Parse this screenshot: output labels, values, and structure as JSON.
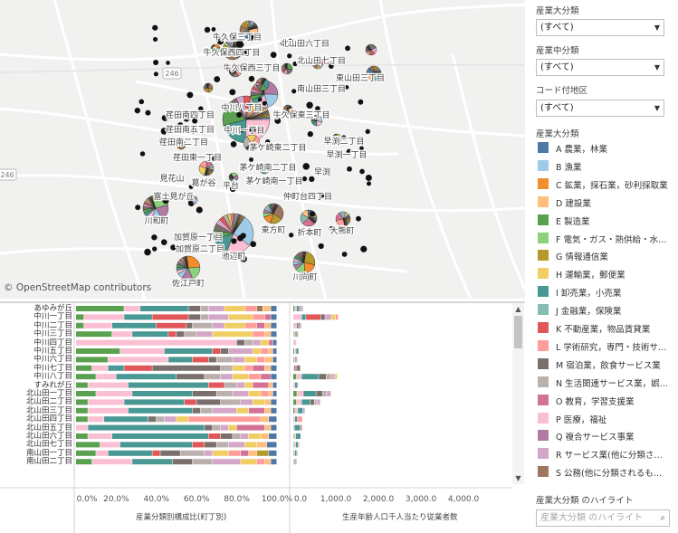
{
  "map": {
    "attribution": "© OpenStreetMap contributors",
    "road_labels": [
      "246",
      "246"
    ],
    "place_labels": [
      "牛久保三丁目",
      "北山田六丁目",
      "北山田七丁目",
      "牛久保西四丁目",
      "牛久保西三丁目",
      "東山田三丁目",
      "南山田三丁目",
      "中川八丁目",
      "荏田南四丁目",
      "牛久保東三丁目",
      "荏田南五丁目",
      "中川一丁目",
      "早渕二丁目",
      "荏田南二丁目",
      "茅ケ崎東二丁目",
      "早渕一丁目",
      "荏田東一丁目",
      "茅ケ崎南二丁目",
      "早渕",
      "見花山",
      "葛が谷",
      "平台",
      "茅ケ崎南一丁目",
      "富士見が丘",
      "仲町台四丁目",
      "川和町",
      "東方町",
      "折本町",
      "大熊町",
      "加賀原一丁目",
      "加賀原二丁目",
      "池辺町",
      "佐江戸町",
      "川向町"
    ]
  },
  "filters": {
    "industry_major_title": "産業大分類",
    "industry_major_value": "(すべて)",
    "industry_middle_title": "産業中分類",
    "industry_middle_value": "(すべて)",
    "district_title": "コード付地区",
    "district_value": "(すべて)"
  },
  "legend": {
    "title": "産業大分類",
    "items": [
      {
        "label": "A 農業，林業",
        "color": "#4e79a7"
      },
      {
        "label": "B 漁業",
        "color": "#a0cbe8"
      },
      {
        "label": "C 鉱業，採石業，砂利採取業",
        "color": "#f28e2b"
      },
      {
        "label": "D 建設業",
        "color": "#ffbe7d"
      },
      {
        "label": "E 製造業",
        "color": "#59a14f"
      },
      {
        "label": "F 電気・ガス・熱供給・水…",
        "color": "#8cd17d"
      },
      {
        "label": "G 情報通信業",
        "color": "#b6992d"
      },
      {
        "label": "H 運輸業，郵便業",
        "color": "#f1ce63"
      },
      {
        "label": "I 卸売業，小売業",
        "color": "#499894"
      },
      {
        "label": "J 金融業，保険業",
        "color": "#86bcb6"
      },
      {
        "label": "K 不動産業，物品賃貸業",
        "color": "#e15759"
      },
      {
        "label": "L 学術研究，専門・技術サ…",
        "color": "#ff9d9a"
      },
      {
        "label": "M 宿泊業，飲食サービス業",
        "color": "#79706e"
      },
      {
        "label": "N 生活関連サービス業，娯…",
        "color": "#bab0ac"
      },
      {
        "label": "O 教育，学習支援業",
        "color": "#d37295"
      },
      {
        "label": "P 医療，福祉",
        "color": "#fabfd2"
      },
      {
        "label": "Q 複合サービス事業",
        "color": "#b07aa1"
      },
      {
        "label": "R サービス業(他に分類さ…",
        "color": "#d4a6c8"
      },
      {
        "label": "S 公務(他に分類されるも…",
        "color": "#9d7660"
      }
    ]
  },
  "highlight": {
    "title": "産業大分類 のハイライト",
    "placeholder": "産業大分類 のハイライト"
  },
  "chart_data": [
    {
      "type": "bar",
      "stacked": true,
      "orientation": "horizontal",
      "title": "産業分類別構成比(町丁別)",
      "categories": [
        "あゆみが丘",
        "中川一丁目",
        "中川二丁目",
        "中川三丁目",
        "中川四丁目",
        "中川五丁目",
        "中川六丁目",
        "中川七丁目",
        "中川八丁目",
        "すみれが丘",
        "北山田一丁目",
        "北山田二丁目",
        "北山田三丁目",
        "北山田四丁目",
        "北山田五丁目",
        "北山田六丁目",
        "北山田七丁目",
        "南山田一丁目",
        "南山田二丁目"
      ],
      "x_ticks": [
        "0.0%",
        "20.0%",
        "40.0%",
        "60.0%",
        "80.0%",
        "100.0%"
      ],
      "xlim": [
        0,
        100
      ],
      "series_order": [
        "E",
        "P",
        "I",
        "K",
        "M",
        "N",
        "R",
        "H",
        "L",
        "O",
        "S",
        "D",
        "J",
        "G",
        "Q",
        "A"
      ],
      "rows": [
        {
          "P": 8,
          "R": 8,
          "M": 6,
          "N": 4,
          "I": 24,
          "E": 24,
          "H": 10,
          "L": 6,
          "D": 4,
          "A": 3,
          "S": 3
        },
        {
          "P": 20,
          "R": 10,
          "K": 18,
          "M": 6,
          "N": 4,
          "I": 14,
          "H": 12,
          "L": 6,
          "E": 4,
          "A": 3,
          "O": 3
        },
        {
          "P": 14,
          "N": 10,
          "O": 4,
          "M": 3,
          "R": 6,
          "I": 22,
          "E": 4,
          "H": 10,
          "L": 6,
          "K": 15,
          "A": 3,
          "D": 3
        },
        {
          "P": 10,
          "R": 8,
          "K": 4,
          "M": 4,
          "N": 6,
          "I": 18,
          "E": 18,
          "H": 20,
          "L": 6,
          "A": 3,
          "D": 3
        },
        {
          "P": 80,
          "M": 4,
          "N": 4,
          "R": 4,
          "H": 4,
          "A": 2,
          "O": 2
        },
        {
          "P": 22,
          "R": 12,
          "M": 4,
          "K": 4,
          "I": 24,
          "E": 22,
          "H": 4,
          "L": 4,
          "A": 2,
          "D": 2
        },
        {
          "P": 30,
          "R": 6,
          "M": 4,
          "N": 8,
          "K": 8,
          "I": 12,
          "E": 16,
          "H": 6,
          "L": 4,
          "A": 2,
          "D": 4
        },
        {
          "P": 8,
          "O": 6,
          "M": 34,
          "N": 6,
          "K": 14,
          "I": 8,
          "E": 8,
          "H": 6,
          "L": 4,
          "A": 3,
          "D": 3
        },
        {
          "P": 10,
          "R": 6,
          "M": 14,
          "N": 8,
          "I": 30,
          "E": 10,
          "H": 8,
          "L": 6,
          "A": 3,
          "O": 5
        },
        {
          "P": 20,
          "R": 4,
          "O": 8,
          "N": 6,
          "K": 8,
          "I": 40,
          "E": 6,
          "H": 4,
          "A": 2,
          "D": 2
        },
        {
          "P": 18,
          "R": 8,
          "M": 12,
          "N": 8,
          "I": 30,
          "E": 10,
          "H": 6,
          "L": 4,
          "A": 2,
          "D": 2
        },
        {
          "P": 18,
          "R": 6,
          "M": 12,
          "N": 10,
          "K": 6,
          "I": 30,
          "E": 6,
          "H": 6,
          "A": 3,
          "D": 3
        },
        {
          "P": 20,
          "R": 12,
          "O": 8,
          "M": 4,
          "N": 6,
          "I": 32,
          "E": 6,
          "H": 6,
          "A": 3,
          "D": 3
        },
        {
          "P": 8,
          "R": 6,
          "M": 4,
          "N": 4,
          "L": 36,
          "I": 22,
          "E": 6,
          "H": 6,
          "A": 4,
          "D": 4
        },
        {
          "P": 6,
          "O": 14,
          "M": 4,
          "N": 4,
          "R": 4,
          "I": 58,
          "H": 4,
          "A": 3,
          "D": 3
        },
        {
          "P": 12,
          "R": 4,
          "M": 6,
          "N": 4,
          "K": 6,
          "I": 48,
          "E": 6,
          "H": 6,
          "A": 4,
          "D": 4
        },
        {
          "P": 10,
          "R": 8,
          "K": 6,
          "M": 6,
          "N": 6,
          "I": 36,
          "E": 12,
          "H": 6,
          "A": 5,
          "D": 5
        },
        {
          "P": 6,
          "R": 4,
          "O": 4,
          "M": 10,
          "N": 12,
          "K": 4,
          "I": 22,
          "G": 6,
          "E": 10,
          "H": 8,
          "L": 6,
          "A": 4,
          "D": 4
        },
        {
          "P": 20,
          "R": 14,
          "M": 10,
          "N": 10,
          "I": 20,
          "E": 8,
          "H": 8,
          "L": 4,
          "A": 3,
          "D": 3
        }
      ]
    },
    {
      "type": "bar",
      "stacked": true,
      "orientation": "horizontal",
      "title": "生産年齢人口千人当たり従業者数",
      "categories": [
        "あゆみが丘",
        "中川一丁目",
        "中川二丁目",
        "中川三丁目",
        "中川四丁目",
        "中川五丁目",
        "中川六丁目",
        "中川七丁目",
        "中川八丁目",
        "すみれが丘",
        "北山田一丁目",
        "北山田二丁目",
        "北山田三丁目",
        "北山田四丁目",
        "北山田五丁目",
        "北山田六丁目",
        "北山田七丁目",
        "南山田一丁目",
        "南山田二丁目"
      ],
      "x_ticks": [
        "0.0",
        "1,000.0",
        "2,000.0",
        "3,000.0",
        "4,000.0"
      ],
      "xlim": [
        0,
        4700
      ],
      "series_order": [
        "E",
        "P",
        "I",
        "K",
        "M",
        "N",
        "R",
        "H",
        "L",
        "O",
        "S",
        "D",
        "J",
        "G",
        "Q",
        "A"
      ],
      "rows": [
        {
          "I": 60,
          "P": 40,
          "M": 30,
          "E": 40,
          "R": 20,
          "K": 20,
          "A": 10
        },
        {
          "P": 200,
          "K": 350,
          "M": 100,
          "R": 150,
          "I": 100,
          "H": 100,
          "L": 60
        },
        {
          "P": 80,
          "R": 40,
          "I": 50,
          "K": 30
        },
        {
          "P": 30,
          "I": 40,
          "E": 20,
          "K": 20,
          "H": 20
        },
        {
          "P": 80
        },
        {
          "P": 40,
          "I": 60,
          "E": 30
        },
        {
          "P": 30,
          "K": 20,
          "I": 30,
          "E": 20
        },
        {
          "M": 80,
          "K": 40,
          "I": 30,
          "P": 20
        },
        {
          "P": 120,
          "R": 80,
          "M": 180,
          "N": 120,
          "I": 400,
          "E": 80,
          "H": 60
        },
        {
          "P": 40,
          "I": 60,
          "K": 20
        },
        {
          "P": 150,
          "R": 100,
          "M": 150,
          "N": 100,
          "I": 300,
          "E": 90
        },
        {
          "P": 120,
          "R": 80,
          "M": 100,
          "N": 60,
          "I": 200,
          "E": 80
        },
        {
          "P": 70,
          "R": 50,
          "I": 120,
          "E": 40
        },
        {
          "P": 40,
          "L": 120,
          "I": 60
        },
        {
          "P": 30,
          "O": 40,
          "I": 140
        },
        {
          "P": 40,
          "I": 120,
          "E": 20
        },
        {
          "P": 40,
          "R": 30,
          "I": 60,
          "E": 20
        },
        {
          "P": 20,
          "M": 20,
          "I": 40,
          "E": 20
        },
        {
          "P": 30,
          "M": 20,
          "I": 30
        }
      ]
    }
  ],
  "axis_titles": {
    "left": "産業分類別構成比(町丁別)",
    "right": "生産年齢人口千人当たり従業者数"
  }
}
